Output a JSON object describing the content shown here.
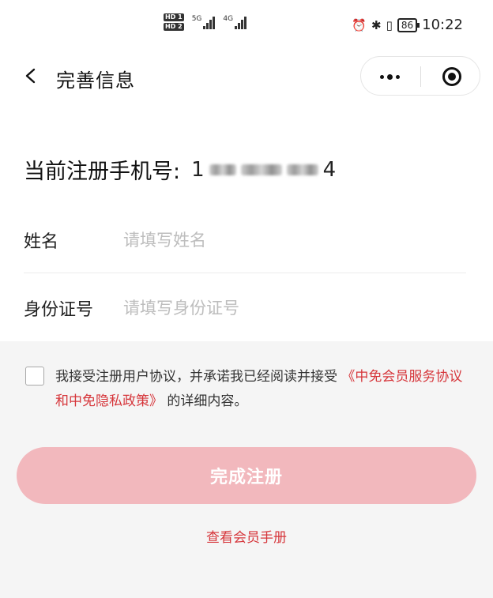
{
  "status_bar": {
    "hd1": "HD 1",
    "hd2": "HD 2",
    "net1": "5G",
    "net2": "4G",
    "alarm_icon": "alarm-icon",
    "bluetooth_icon": "bluetooth-icon",
    "vibrate_icon": "vibrate-icon",
    "battery": "86",
    "time": "10:22"
  },
  "nav": {
    "title": "完善信息"
  },
  "phone": {
    "label": "当前注册手机号:",
    "first_digit": "1",
    "last_digit": "4"
  },
  "form": {
    "name_label": "姓名",
    "name_placeholder": "请填写姓名",
    "id_label": "身份证号",
    "id_placeholder": "请填写身份证号"
  },
  "agreement": {
    "text_before": "我接受注册用户协议，并承诺我已经阅读并接受",
    "link_text": "《中免会员服务协议和中免隐私政策》",
    "text_after": "的详细内容。",
    "checked": false
  },
  "submit_label": "完成注册",
  "handbook_link": "查看会员手册",
  "colors": {
    "accent": "#d6363b",
    "button_bg": "#f2b8bd",
    "section_bg": "#f5f5f5"
  }
}
